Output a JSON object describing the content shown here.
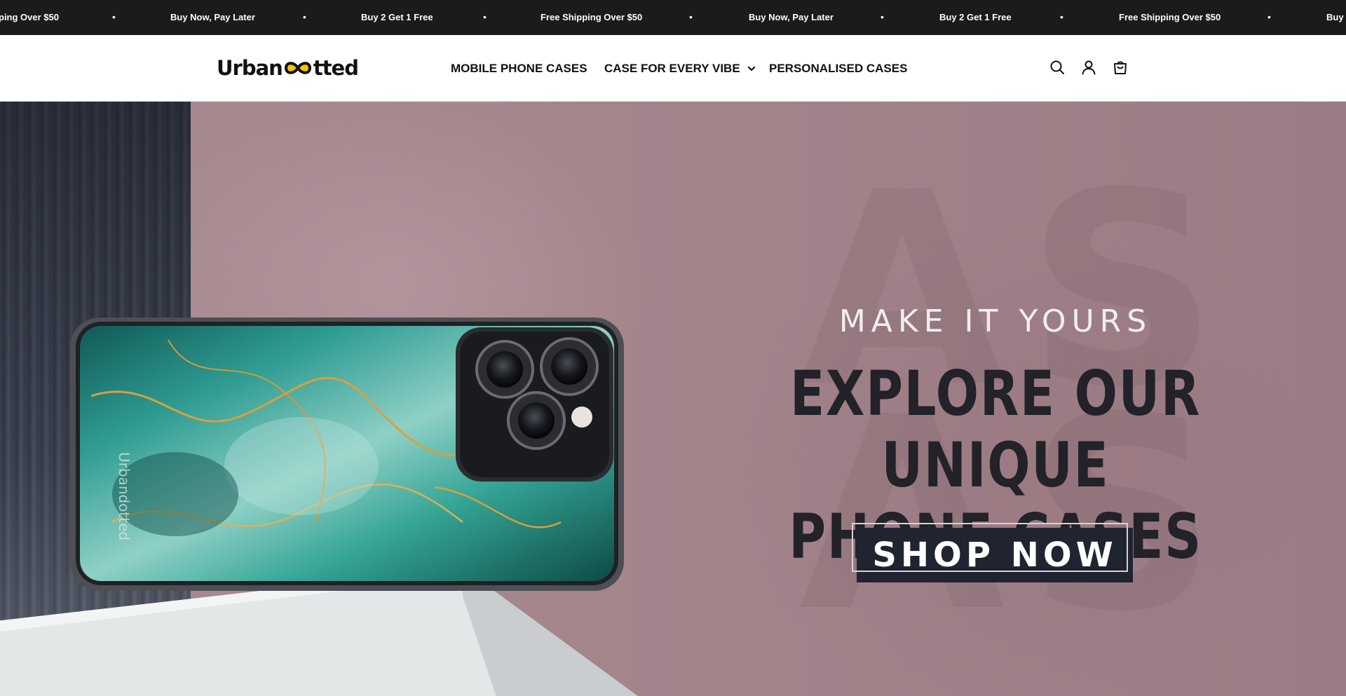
{
  "announcement": {
    "items": [
      "ping Over $50",
      "Buy Now, Pay Later",
      "Buy 2 Get 1 Free",
      "Free Shipping Over $50",
      "Buy Now, Pay Later",
      "Buy 2 Get 1 Free",
      "Free Shipping Over $50",
      "Buy N"
    ],
    "separator": "•",
    "background": "#1b1b1b"
  },
  "header": {
    "logo_left": "Urban",
    "logo_right": "tted",
    "logo_accent": "#f5c400",
    "nav": [
      {
        "label": "MOBILE PHONE CASES"
      },
      {
        "label": "CASE FOR EVERY VIBE",
        "icon": "chevron-down-icon"
      },
      {
        "label": "PERSONALISED CASES"
      }
    ],
    "icons": [
      "search-icon",
      "account-icon",
      "cart-icon"
    ]
  },
  "hero": {
    "subtitle": "MAKE IT YOURS",
    "title_line1": "EXPLORE OUR UNIQUE",
    "title_line2": "PHONE CASES",
    "cta": "SHOP NOW",
    "phone_brand": "Urbandotted",
    "background": "#a4858c"
  }
}
